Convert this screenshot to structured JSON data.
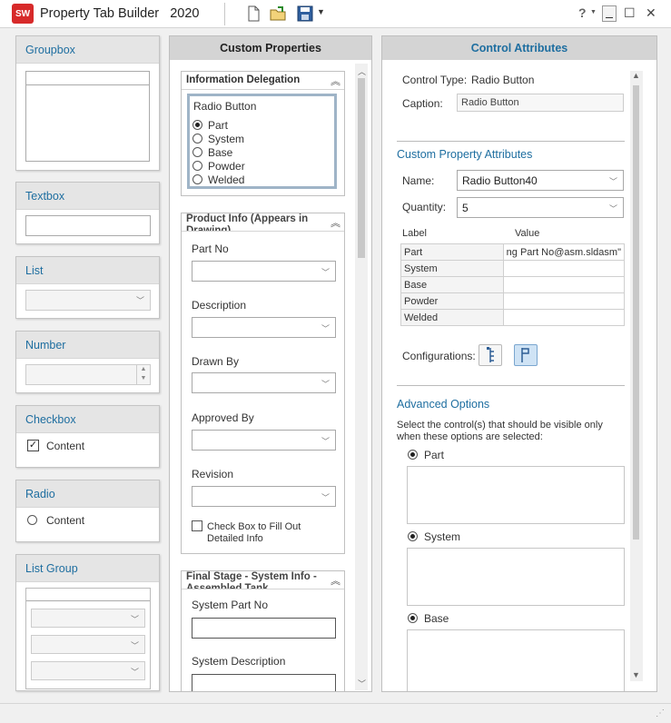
{
  "app": {
    "title": "Property Tab Builder   2020",
    "logo_text": "SW",
    "help_label": "?"
  },
  "toolbox": [
    {
      "key": "groupbox",
      "label": "Groupbox"
    },
    {
      "key": "textbox",
      "label": "Textbox"
    },
    {
      "key": "list",
      "label": "List"
    },
    {
      "key": "number",
      "label": "Number"
    },
    {
      "key": "checkbox",
      "label": "Checkbox",
      "content": "Content"
    },
    {
      "key": "radio",
      "label": "Radio",
      "content": "Content"
    },
    {
      "key": "listgroup",
      "label": "List Group"
    }
  ],
  "custom_properties": {
    "title": "Custom Properties",
    "info_delegation": {
      "title": "Information Delegation",
      "radio_group_label": "Radio Button",
      "options": [
        "Part",
        "System",
        "Base",
        "Powder",
        "Welded"
      ],
      "selected": "Part"
    },
    "product_info": {
      "title": "Product Info (Appears in Drawing)",
      "fields": [
        "Part No",
        "Description",
        "Drawn By",
        "Approved By",
        "Revision"
      ],
      "checkbox_label": "Check Box to Fill Out Detailed Info"
    },
    "final_stage": {
      "title": "Final Stage - System Info - Assembled Tank",
      "fields": [
        "System Part No",
        "System Description"
      ]
    }
  },
  "control_attributes": {
    "title": "Control Attributes",
    "control_type_label": "Control Type:",
    "control_type_value": "Radio Button",
    "caption_label": "Caption:",
    "caption_value": "Radio Button",
    "custom_attr_title": "Custom Property Attributes",
    "name_label": "Name:",
    "name_value": "Radio Button40",
    "quantity_label": "Quantity:",
    "quantity_value": "5",
    "table_headers": [
      "Label",
      "Value"
    ],
    "table_rows": [
      {
        "label": "Part",
        "value": "ng Part No@asm.sldasm\""
      },
      {
        "label": "System",
        "value": ""
      },
      {
        "label": "Base",
        "value": ""
      },
      {
        "label": "Powder",
        "value": ""
      },
      {
        "label": "Welded",
        "value": ""
      }
    ],
    "configurations_label": "Configurations:",
    "advanced_title": "Advanced Options",
    "advanced_desc": "Select the control(s) that should be visible only when these options are selected:",
    "advanced_options": [
      "Part",
      "System",
      "Base"
    ]
  },
  "colors": {
    "accent": "#1e6ea0",
    "header_bg": "#d4d4d4",
    "logo": "#d72a2a"
  }
}
